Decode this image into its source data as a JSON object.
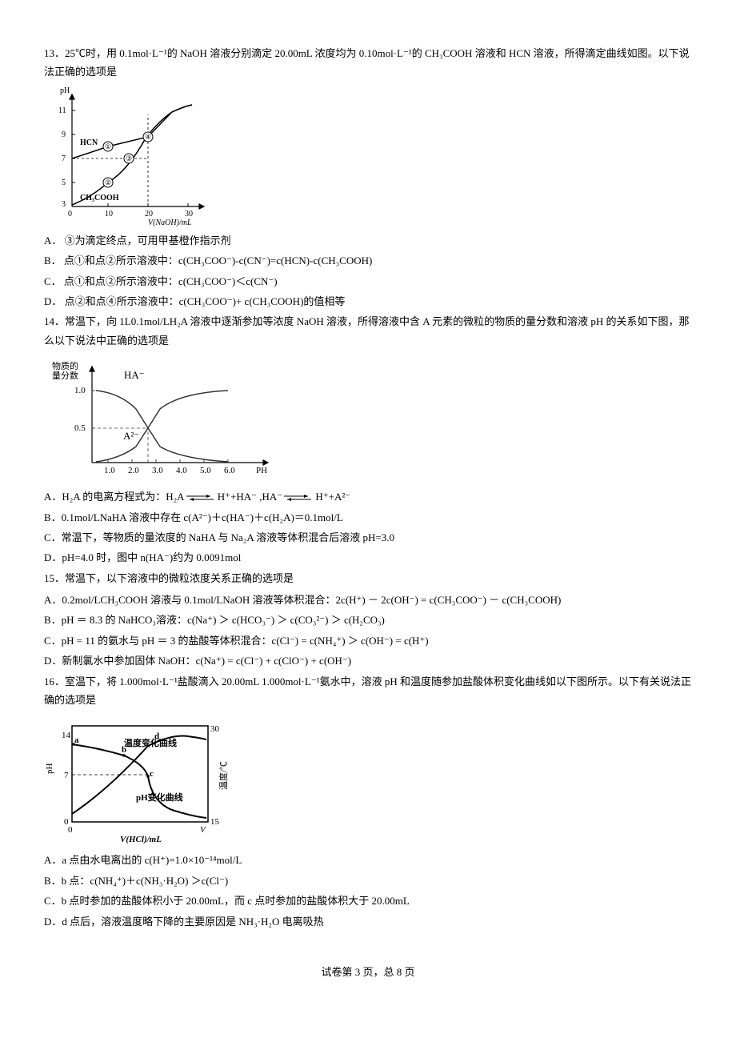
{
  "q13": {
    "stem": "13．25℃时，用 0.1mol·L⁻¹的 NaOH 溶液分别滴定 20.00mL 浓度均为 0.10mol·L⁻¹的 CH₃COOH 溶液和 HCN 溶液，所得滴定曲线如图。以下说法正确的选项是",
    "optA": "A． ③为滴定终点，可用甲基橙作指示剂",
    "optB": "B． 点①和点②所示溶液中：c(CH₃COO⁻)-c(CN⁻)=c(HCN)-c(CH₃COOH)",
    "optC": "C． 点①和点②所示溶液中：c(CH₃COO⁻)＜c(CN⁻)",
    "optD": "D． 点②和点④所示溶液中：c(CH₃COO⁻)+ c(CH₃COOH)的值相等",
    "chart_data": {
      "type": "line",
      "title": "",
      "xlabel": "V(NaOH)/mL",
      "ylabel": "pH",
      "xlim": [
        0,
        30
      ],
      "ylim": [
        3,
        11
      ],
      "x_ticks": [
        0,
        10,
        20,
        30
      ],
      "y_ticks": [
        3,
        5,
        7,
        9,
        11
      ],
      "series": [
        {
          "name": "HCN",
          "x": [
            0,
            5,
            10,
            15,
            20,
            25,
            30
          ],
          "values": [
            7,
            7.6,
            8,
            8.3,
            8.8,
            10.2,
            10.8
          ]
        },
        {
          "name": "CH₃COOH",
          "x": [
            0,
            5,
            10,
            15,
            20,
            25,
            30
          ],
          "values": [
            3,
            4,
            5,
            6,
            8.7,
            10.2,
            10.8
          ]
        }
      ],
      "annotations": [
        {
          "label": "①",
          "x": 10,
          "y": 8
        },
        {
          "label": "②",
          "x": 10,
          "y": 5
        },
        {
          "label": "③",
          "x": 15.5,
          "y": 7
        },
        {
          "label": "④",
          "x": 20,
          "y": 8.8
        }
      ],
      "dashed_lines": [
        {
          "type": "horizontal",
          "y": 7
        },
        {
          "type": "vertical",
          "x": 20
        }
      ]
    }
  },
  "q14": {
    "stem": "14．常温下，向 1L0.1mol/LH₂A 溶液中逐渐参加等浓度 NaOH 溶液，所得溶液中含 A 元素的微粒的物质的量分数和溶液 pH 的关系如下图，那么以下说法中正确的选项是",
    "optA_prefix": "A．H₂A 的电离方程式为：H₂A",
    "optA_mid": " H⁺+HA⁻ ,HA⁻",
    "optA_suffix": " H⁺+A²⁻",
    "optB": "B．0.1mol/LNaHA 溶液中存在 c(A²⁻)＋c(HA⁻)＋c(H₂A)＝0.1mol/L",
    "optC": "C．常温下，等物质的量浓度的 NaHA 与 Na₂A 溶液等体积混合后溶液 pH=3.0",
    "optD": "D．pH=4.0 时，图中 n(HA⁻)约为 0.0091mol",
    "chart_data": {
      "type": "line",
      "title": "",
      "xlabel": "PH",
      "ylabel": "物质的量分数",
      "xlim": [
        1.0,
        6.0
      ],
      "ylim": [
        0,
        1.0
      ],
      "x_ticks": [
        1.0,
        2.0,
        3.0,
        4.0,
        5.0,
        6.0
      ],
      "y_ticks": [
        0.5,
        1.0
      ],
      "series": [
        {
          "name": "HA⁻",
          "x": [
            1.0,
            2.0,
            2.7,
            3.5,
            4.5,
            6.0
          ],
          "values": [
            1.0,
            0.9,
            0.5,
            0.15,
            0.03,
            0
          ]
        },
        {
          "name": "A²⁻",
          "x": [
            1.0,
            2.0,
            2.7,
            3.5,
            4.5,
            6.0
          ],
          "values": [
            0,
            0.1,
            0.5,
            0.85,
            0.97,
            1.0
          ]
        }
      ],
      "annotations": [
        {
          "label": "HA⁻",
          "x": 2.0,
          "y": 1.05
        },
        {
          "label": "A²⁻",
          "x": 1.8,
          "y": 0.45
        }
      ],
      "dashed_lines": [
        {
          "type": "horizontal",
          "y": 0.5
        },
        {
          "type": "vertical",
          "x": 2.7
        }
      ]
    }
  },
  "q15": {
    "stem": "15．常温下，以下溶液中的微粒浓度关系正确的选项是",
    "optA": "A．0.2mol/LCH₃COOH 溶液与 0.1mol/LNaOH 溶液等体积混合：2c(H⁺) － 2c(OH⁻) = c(CH₃COO⁻) － c(CH₃COOH)",
    "optB": "B．pH ＝ 8.3 的 NaHCO₃溶液：c(Na⁺) ＞ c(HCO₃⁻) ＞ c(CO₃²⁻) ＞ c(H₂CO₃)",
    "optC": "C．pH = 11 的氨水与 pH ＝ 3 的盐酸等体积混合：c(Cl⁻) = c(NH₄⁺) ＞ c(OH⁻) = c(H⁺)",
    "optD": "D．新制氯水中参加固体 NaOH：c(Na⁺) = c(Cl⁻) + c(ClO⁻) + c(OH⁻)"
  },
  "q16": {
    "stem": "16．室温下，将 1.000mol·L⁻¹盐酸滴入 20.00mL 1.000mol·L⁻¹氨水中，溶液 pH 和温度随参加盐酸体积变化曲线如以下图所示。以下有关说法正确的选项是",
    "optA": "A．a 点由水电离出的 c(H⁺)=1.0×10⁻¹⁴mol/L",
    "optB": "B．b 点：c(NH₄⁺)＋c(NH₃·H₂O) ＞c(Cl⁻)",
    "optC": "C．b 点时参加的盐酸体积小于 20.00mL，而 c 点时参加的盐酸体积大于 20.00mL",
    "optD": "D．d 点后，溶液温度略下降的主要原因是 NH₃·H₂O 电离吸热",
    "chart_data": {
      "type": "line",
      "title": "",
      "xlabel": "V(HCl)/mL",
      "ylabel_left": "pH",
      "ylabel_right": "温度/℃",
      "xlim": [
        0,
        30
      ],
      "y_left_ticks": [
        0,
        7,
        14
      ],
      "y_right_ticks": [
        15,
        30
      ],
      "series": [
        {
          "name": "pH变化曲线",
          "axis": "left",
          "x": [
            0,
            8,
            15,
            18,
            22,
            30
          ],
          "values": [
            12,
            10,
            8,
            5,
            3,
            2
          ]
        },
        {
          "name": "温度变化曲线",
          "axis": "right",
          "x": [
            0,
            10,
            20,
            30
          ],
          "values": [
            16,
            22,
            28,
            27
          ]
        }
      ],
      "annotations": [
        {
          "label": "a",
          "x": 0,
          "y_axis": "left",
          "y": 12
        },
        {
          "label": "b",
          "x": 10,
          "y_axis": "left",
          "y": 10
        },
        {
          "label": "c",
          "x": 18,
          "y_axis": "left",
          "y": 7
        },
        {
          "label": "d",
          "x": 20,
          "y_axis": "right",
          "y": 28
        }
      ],
      "dashed_lines": [
        {
          "type": "horizontal",
          "y_left": 7
        }
      ]
    }
  },
  "footer": "试卷第 3 页，总 8 页"
}
